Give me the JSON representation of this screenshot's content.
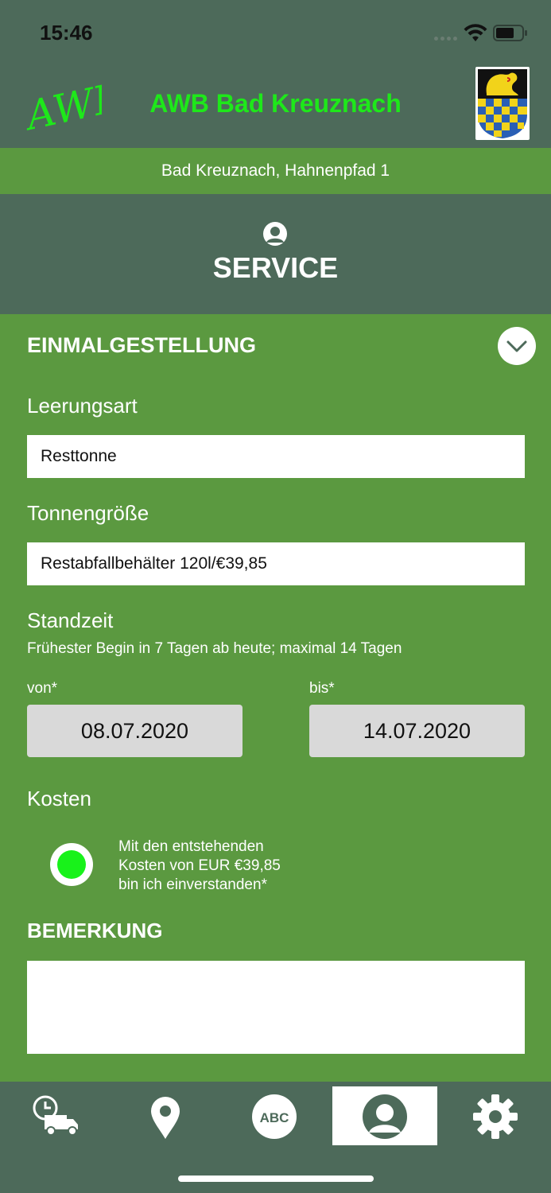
{
  "status_bar": {
    "time": "15:46"
  },
  "header": {
    "title": "AWB Bad Kreuznach",
    "logo_text": "AWB"
  },
  "address": "Bad Kreuznach, Hahnenpfad 1",
  "section": {
    "title": "SERVICE",
    "icon": "person-icon"
  },
  "form": {
    "title": "EINMALGESTELLUNG",
    "leerungsart_label": "Leerungsart",
    "leerungsart_value": "Resttonne",
    "tonnengroesse_label": "Tonnengröße",
    "tonnengroesse_value": "Restabfallbehälter 120l/€39,85",
    "standzeit_label": "Standzeit",
    "standzeit_hint": "Frühester Begin in 7 Tagen ab heute; maximal 14 Tagen",
    "von_label": "von*",
    "von_value": "08.07.2020",
    "bis_label": "bis*",
    "bis_value": "14.07.2020",
    "kosten_label": "Kosten",
    "consent_lines": [
      "Mit den entstehenden",
      "Kosten von EUR €39,85",
      "bin ich einverstanden*"
    ],
    "consent_checked": true,
    "bemerkung_label": "BEMERKUNG",
    "bemerkung_value": ""
  },
  "tabbar": {
    "items": [
      {
        "icon": "schedule-truck-icon",
        "active": false
      },
      {
        "icon": "location-pin-icon",
        "active": false
      },
      {
        "icon": "abc-icon",
        "label": "ABC",
        "active": false
      },
      {
        "icon": "person-icon",
        "active": true
      },
      {
        "icon": "gear-icon",
        "active": false
      }
    ]
  },
  "colors": {
    "primary_green": "#5b9940",
    "dark_green": "#4d6a5a",
    "title_green": "#1ee81a",
    "radio_green": "#18f21a"
  }
}
